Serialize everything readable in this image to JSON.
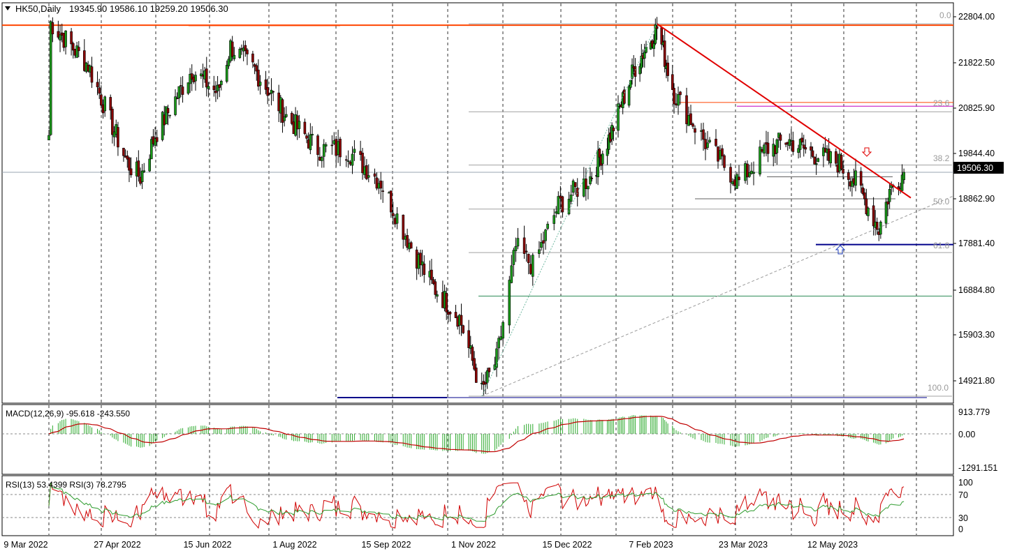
{
  "header": {
    "symbol": "HK50,Daily",
    "ohlc": "19345.90 19586.10 19259.20 19506.30"
  },
  "panels": {
    "price": {
      "y_ticks": [
        "22804.00",
        "21822.50",
        "20825.90",
        "19844.40",
        "18862.90",
        "17881.40",
        "16884.80",
        "15903.30",
        "14921.80"
      ],
      "current_price_label": "19506.30",
      "fib_labels": [
        "0.0",
        "23.6",
        "38.2",
        "50.0",
        "61.8",
        "100.0"
      ]
    },
    "macd": {
      "title": "MACD(12,26,9) -95.618 -243.550",
      "y_ticks": [
        "913.779",
        "0.00",
        "-1291.151"
      ]
    },
    "rsi": {
      "title": "RSI(13) 53.4399  RSI(3) 78.2795",
      "y_ticks": [
        "100",
        "70",
        "30",
        "0"
      ]
    }
  },
  "x_labels": [
    "9 Mar 2022",
    "27 Apr 2022",
    "15 Jun 2022",
    "1 Aug 2022",
    "15 Sep 2022",
    "1 Nov 2022",
    "15 Dec 2022",
    "7 Feb 2023",
    "23 Mar 2023",
    "12 May 2023"
  ],
  "colors": {
    "bull_candle": "#1a9c1a",
    "bear_candle": "#8b0000",
    "resistance_line": "#ff4500",
    "trend_line": "#e00000",
    "support_line": "#00008b",
    "fib_line": "#a0a0a0",
    "macd_hist": "#2eaa2e",
    "macd_signal": "#c00000",
    "rsi13": "#2e9c2e",
    "rsi3": "#d00000",
    "magenta_line": "#c000c0",
    "green_level": "#2e8b57"
  },
  "chart_data": {
    "type": "candlestick",
    "period": "Daily",
    "symbol": "HK50",
    "ylim": [
      14600,
      23100
    ],
    "x": [
      "9 Mar 2022",
      "27 Apr 2022",
      "15 Jun 2022",
      "1 Aug 2022",
      "15 Sep 2022",
      "1 Nov 2022",
      "15 Dec 2022",
      "7 Feb 2023",
      "23 Mar 2023",
      "12 May 2023"
    ],
    "anchors": [
      {
        "date": "9 Mar 2022",
        "close": 20300
      },
      {
        "date": "10 Mar 2022",
        "close": 22700
      },
      {
        "date": "30 Mar 2022",
        "close": 21800
      },
      {
        "date": "20 Apr 2022",
        "close": 19700
      },
      {
        "date": "27 Apr 2022",
        "close": 19400
      },
      {
        "date": "5 May 2022",
        "close": 20300
      },
      {
        "date": "25 May 2022",
        "close": 21700
      },
      {
        "date": "8 Jun 2022",
        "close": 21200
      },
      {
        "date": "15 Jun 2022",
        "close": 22200
      },
      {
        "date": "28 Jun 2022",
        "close": 21700
      },
      {
        "date": "15 Jul 2022",
        "close": 20700
      },
      {
        "date": "1 Aug 2022",
        "close": 20000
      },
      {
        "date": "15 Aug 2022",
        "close": 20000
      },
      {
        "date": "1 Sep 2022",
        "close": 19300
      },
      {
        "date": "15 Sep 2022",
        "close": 18000
      },
      {
        "date": "27 Sep 2022",
        "close": 17100
      },
      {
        "date": "12 Oct 2022",
        "close": 16400
      },
      {
        "date": "24 Oct 2022",
        "close": 14800
      },
      {
        "date": "1 Nov 2022",
        "close": 15500
      },
      {
        "date": "10 Nov 2022",
        "close": 17900
      },
      {
        "date": "18 Nov 2022",
        "close": 17500
      },
      {
        "date": "30 Nov 2022",
        "close": 18800
      },
      {
        "date": "15 Dec 2022",
        "close": 19400
      },
      {
        "date": "28 Dec 2022",
        "close": 20300
      },
      {
        "date": "12 Jan 2023",
        "close": 21700
      },
      {
        "date": "27 Jan 2023",
        "close": 22600
      },
      {
        "date": "7 Feb 2023",
        "close": 21200
      },
      {
        "date": "24 Feb 2023",
        "close": 20000
      },
      {
        "date": "10 Mar 2023",
        "close": 19300
      },
      {
        "date": "23 Mar 2023",
        "close": 20000
      },
      {
        "date": "4 Apr 2023",
        "close": 20200
      },
      {
        "date": "18 Apr 2023",
        "close": 19900
      },
      {
        "date": "3 May 2023",
        "close": 19700
      },
      {
        "date": "12 May 2023",
        "close": 19300
      },
      {
        "date": "25 May 2023",
        "close": 18300
      },
      {
        "date": "31 May 2023",
        "close": 19100
      },
      {
        "date": "8 Jun 2023",
        "close": 19506.3
      }
    ],
    "last_bar": {
      "open": 19345.9,
      "high": 19586.1,
      "low": 19259.2,
      "close": 19506.3
    },
    "levels": {
      "resistance": 22650,
      "top_short_line": 22640,
      "support_low": 14690,
      "support_mid": 17960,
      "green_level": 16860,
      "orange_short": 21000,
      "magenta": 20920,
      "swing_low_line": 18940,
      "mid_line": 19410
    },
    "fibonacci": [
      {
        "level": "0.0",
        "price": 22680
      },
      {
        "level": "23.6",
        "price": 20800
      },
      {
        "level": "38.2",
        "price": 19660
      },
      {
        "level": "50.0",
        "price": 18720
      },
      {
        "level": "61.8",
        "price": 17790
      },
      {
        "level": "100.0",
        "price": 14720
      }
    ],
    "macd": {
      "name": "MACD(12,26,9)",
      "main": -95.618,
      "signal": -243.55,
      "ylim": [
        -1291.151,
        913.779
      ]
    },
    "rsi": {
      "rsi13": 53.4399,
      "rsi3": 78.2795,
      "ylim": [
        0,
        100
      ],
      "levels": [
        70,
        30
      ]
    }
  }
}
